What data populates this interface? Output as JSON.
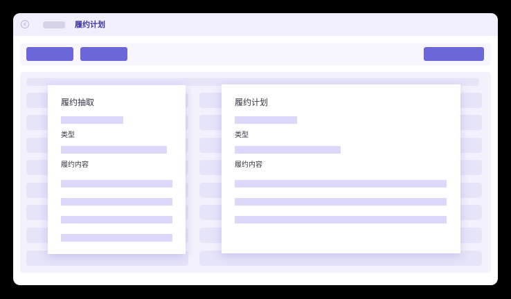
{
  "header": {
    "title": "履约计划"
  },
  "extract_card": {
    "title": "履约抽取",
    "type_label": "类型",
    "content_label": "履约内容"
  },
  "plan_card": {
    "title": "履约计划",
    "type_label": "类型",
    "content_label": "履约内容"
  },
  "colors": {
    "accent": "#6b67d9",
    "title_text": "#3f37a8",
    "placeholder": "#dcd8fa"
  }
}
